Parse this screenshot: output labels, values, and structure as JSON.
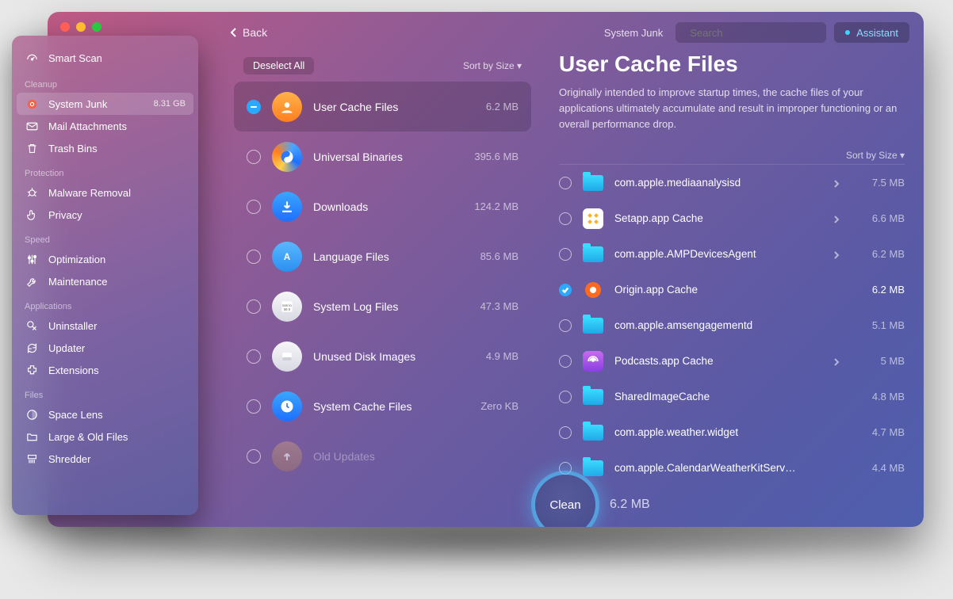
{
  "window": {
    "back_label": "Back",
    "breadcrumb": "System Junk",
    "search_placeholder": "Search",
    "assistant_label": "Assistant"
  },
  "sidebar": {
    "smart_scan": "Smart Scan",
    "sections": {
      "cleanup": "Cleanup",
      "protection": "Protection",
      "speed": "Speed",
      "applications": "Applications",
      "files": "Files"
    },
    "items": {
      "system_junk": "System Junk",
      "system_junk_size": "8.31 GB",
      "mail_attachments": "Mail Attachments",
      "trash_bins": "Trash Bins",
      "malware_removal": "Malware Removal",
      "privacy": "Privacy",
      "optimization": "Optimization",
      "maintenance": "Maintenance",
      "uninstaller": "Uninstaller",
      "updater": "Updater",
      "extensions": "Extensions",
      "space_lens": "Space Lens",
      "large_old": "Large & Old Files",
      "shredder": "Shredder"
    }
  },
  "middle": {
    "deselect_label": "Deselect All",
    "sort_label": "Sort by Size",
    "categories": [
      {
        "name": "User Cache Files",
        "size": "6.2 MB",
        "selected": true,
        "radio": "dash",
        "icon": "user",
        "bg": "bg-orange"
      },
      {
        "name": "Universal Binaries",
        "size": "395.6 MB",
        "icon": "yinyang",
        "bg": "bg-yy"
      },
      {
        "name": "Downloads",
        "size": "124.2 MB",
        "icon": "download",
        "bg": "bg-blue"
      },
      {
        "name": "Language Files",
        "size": "85.6 MB",
        "icon": "A",
        "bg": "bg-sky"
      },
      {
        "name": "System Log Files",
        "size": "47.3 MB",
        "icon": "log",
        "bg": "bg-white"
      },
      {
        "name": "Unused Disk Images",
        "size": "4.9 MB",
        "icon": "disk",
        "bg": "bg-white"
      },
      {
        "name": "System Cache Files",
        "size": "Zero KB",
        "icon": "clock",
        "bg": "bg-blue"
      },
      {
        "name": "Old Updates",
        "size": "",
        "dim": true,
        "icon": "up",
        "bg": "bg-dim"
      }
    ]
  },
  "detail": {
    "title": "User Cache Files",
    "description": "Originally intended to improve startup times, the cache files of your applications ultimately accumulate and result in improper functioning or an overall performance drop.",
    "sort_label": "Sort by Size",
    "items": [
      {
        "name": "com.apple.mediaanalysisd",
        "size": "7.5 MB",
        "type": "folder",
        "chev": true
      },
      {
        "name": "Setapp.app Cache",
        "size": "6.6 MB",
        "type": "setapp",
        "chev": true
      },
      {
        "name": "com.apple.AMPDevicesAgent",
        "size": "6.2 MB",
        "type": "folder",
        "chev": true
      },
      {
        "name": "Origin.app Cache",
        "size": "6.2 MB",
        "type": "origin",
        "checked": true,
        "selected": true
      },
      {
        "name": "com.apple.amsengagementd",
        "size": "5.1 MB",
        "type": "folder"
      },
      {
        "name": "Podcasts.app Cache",
        "size": "5 MB",
        "type": "podcasts",
        "chev": true
      },
      {
        "name": "SharedImageCache",
        "size": "4.8 MB",
        "type": "folder"
      },
      {
        "name": "com.apple.weather.widget",
        "size": "4.7 MB",
        "type": "folder"
      },
      {
        "name": "com.apple.CalendarWeatherKitService",
        "size": "4.4 MB",
        "type": "folder"
      }
    ]
  },
  "clean": {
    "label": "Clean",
    "size": "6.2 MB"
  }
}
